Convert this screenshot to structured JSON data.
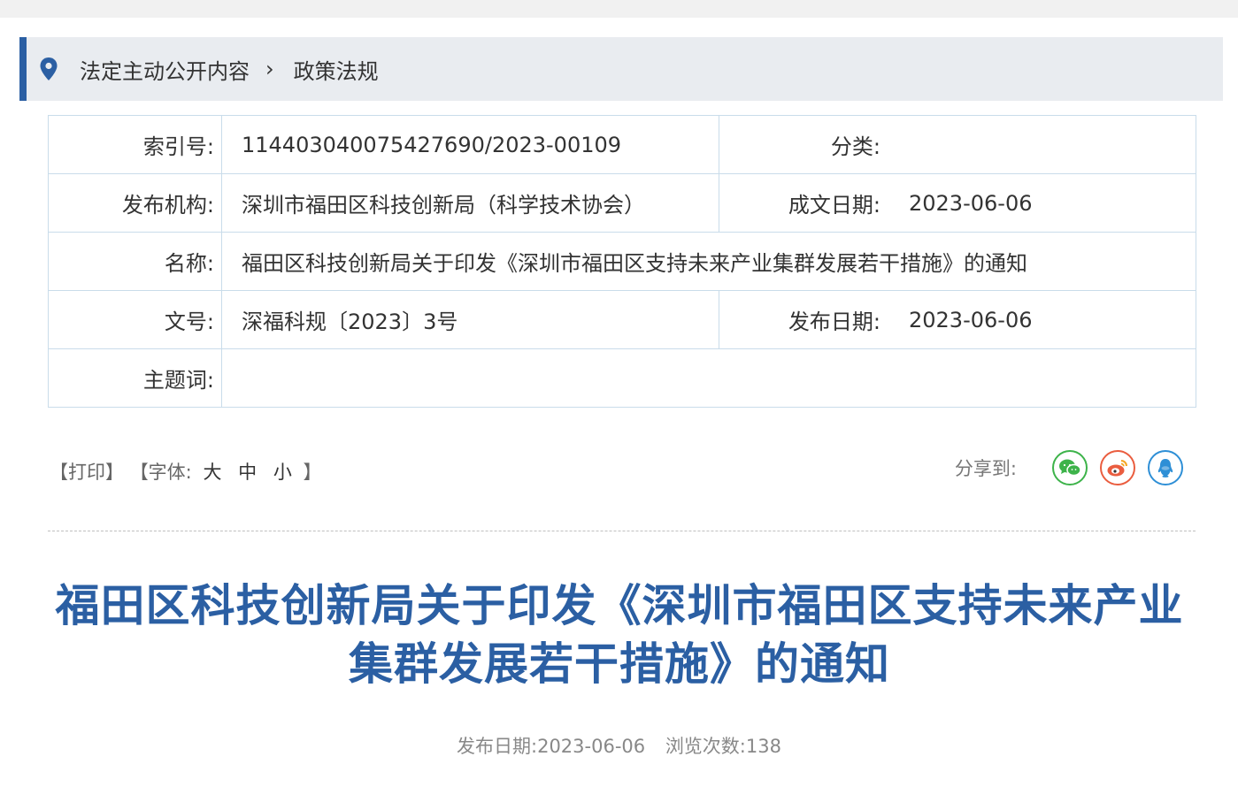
{
  "breadcrumb": {
    "items": [
      "法定主动公开内容",
      "政策法规"
    ],
    "separator": "›",
    "icon": "location-pin-icon"
  },
  "info": {
    "index_label": "索引号:",
    "index_value": "114403040075427690/2023-00109",
    "category_label": "分类:",
    "category_value": "",
    "publisher_label": "发布机构:",
    "publisher_value": "深圳市福田区科技创新局（科学技术协会）",
    "written_date_label": "成文日期:",
    "written_date_value": "2023-06-06",
    "name_label": "名称:",
    "name_value": "福田区科技创新局关于印发《深圳市福田区支持未来产业集群发展若干措施》的通知",
    "doc_no_label": "文号:",
    "doc_no_value": "深福科规〔2023〕3号",
    "publish_date_label": "发布日期:",
    "publish_date_value": "2023-06-06",
    "keywords_label": "主题词:",
    "keywords_value": ""
  },
  "tools": {
    "print": "【打印】",
    "font_prefix": "【字体:",
    "font_large": "大",
    "font_medium": "中",
    "font_small": "小",
    "font_suffix": "】"
  },
  "share": {
    "label": "分享到:",
    "buttons": [
      "wechat-icon",
      "weibo-icon",
      "qq-icon"
    ]
  },
  "article": {
    "title": "福田区科技创新局关于印发《深圳市福田区支持未来产业集群发展若干措施》的通知",
    "publish_date_label": "发布日期:",
    "publish_date": "2023-06-06",
    "views_label": "浏览次数:",
    "views": "138"
  },
  "colors": {
    "accent": "#2b5fa3",
    "breadcrumb_bg": "#e9ecf0",
    "table_border": "#c9dcea",
    "wechat": "#3db34a",
    "weibo": "#ea5d3f",
    "qq": "#2e8fd6"
  }
}
